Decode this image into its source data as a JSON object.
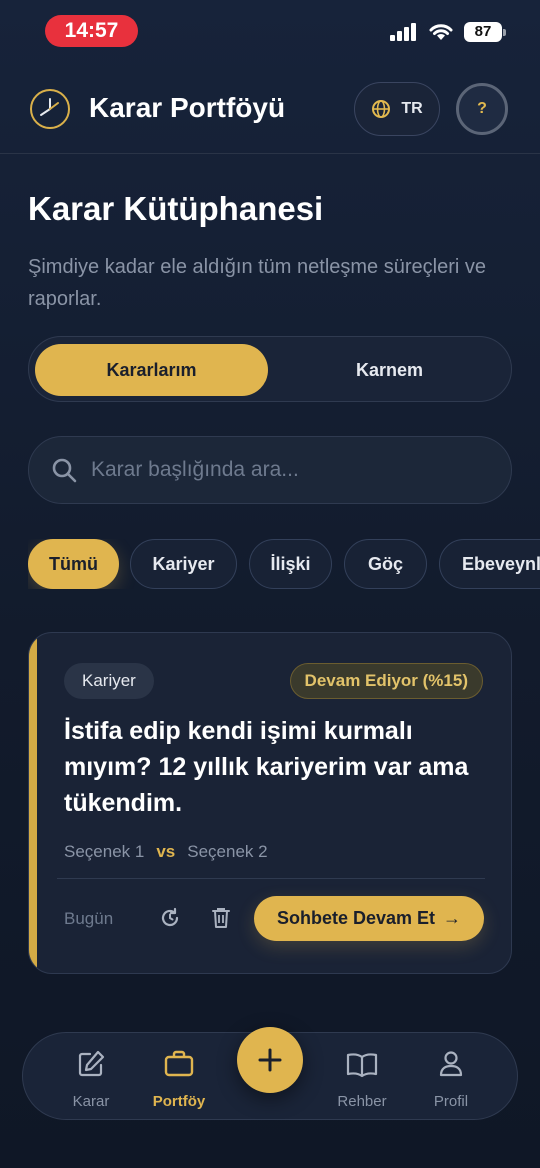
{
  "status_bar": {
    "time": "14:57",
    "battery": "87"
  },
  "header": {
    "app_title": "Karar Portföyü",
    "language": "TR",
    "help": "?"
  },
  "page": {
    "title": "Karar Kütüphanesi",
    "subtitle": "Şimdiye kadar ele aldığın tüm netleşme süreçleri ve raporlar."
  },
  "segments": [
    {
      "label": "Kararlarım",
      "active": true
    },
    {
      "label": "Karnem",
      "active": false
    }
  ],
  "search": {
    "placeholder": "Karar başlığında ara..."
  },
  "filters": [
    {
      "label": "Tümü",
      "active": true
    },
    {
      "label": "Kariyer",
      "active": false
    },
    {
      "label": "İlişki",
      "active": false
    },
    {
      "label": "Göç",
      "active": false
    },
    {
      "label": "Ebeveynlik",
      "active": false
    }
  ],
  "decision_card": {
    "category": "Kariyer",
    "status": "Devam Ediyor (%15)",
    "title": "İstifa edip kendi işimi kurmalı mıyım? 12 yıllık kariyerim var ama tükendim.",
    "option_a": "Seçenek 1",
    "vs": "vs",
    "option_b": "Seçenek 2",
    "date": "Bugün",
    "continue_label": "Sohbete Devam Et",
    "continue_arrow": "→"
  },
  "tabbar": {
    "items": [
      {
        "label": "Karar",
        "icon": "edit-icon",
        "active": false
      },
      {
        "label": "Portföy",
        "icon": "briefcase-icon",
        "active": true
      },
      {
        "label": "Rehber",
        "icon": "book-icon",
        "active": false
      },
      {
        "label": "Profil",
        "icon": "user-icon",
        "active": false
      }
    ],
    "fab": "+"
  },
  "colors": {
    "accent": "#e0b54f",
    "background": "#121b2c",
    "card": "#1a2336",
    "muted": "#8a94a6"
  }
}
